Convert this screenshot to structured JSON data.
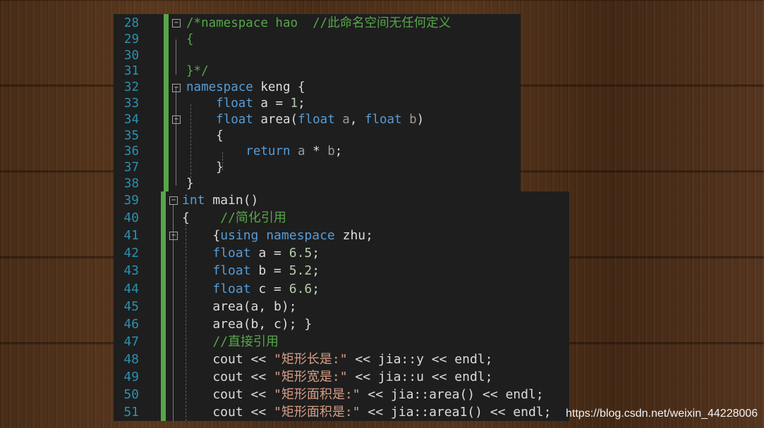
{
  "editor_top": {
    "lines": [
      {
        "num": "28",
        "tokens": [
          {
            "t": "/*namespace hao  //此命名空间无任何定义",
            "c": "c"
          }
        ]
      },
      {
        "num": "29",
        "tokens": [
          {
            "t": "{",
            "c": "c"
          }
        ]
      },
      {
        "num": "30",
        "tokens": []
      },
      {
        "num": "31",
        "tokens": [
          {
            "t": "}*/",
            "c": "c"
          }
        ]
      },
      {
        "num": "32",
        "tokens": [
          {
            "t": "namespace",
            "c": "k"
          },
          {
            "t": " keng {",
            "c": ""
          }
        ]
      },
      {
        "num": "33",
        "tokens": [
          {
            "t": "    ",
            "c": ""
          },
          {
            "t": "float",
            "c": "k"
          },
          {
            "t": " a = ",
            "c": ""
          },
          {
            "t": "1",
            "c": "n"
          },
          {
            "t": ";",
            "c": ""
          }
        ]
      },
      {
        "num": "34",
        "tokens": [
          {
            "t": "    ",
            "c": ""
          },
          {
            "t": "float",
            "c": "k"
          },
          {
            "t": " area(",
            "c": ""
          },
          {
            "t": "float",
            "c": "k"
          },
          {
            "t": " a",
            "c": "p"
          },
          {
            "t": ", ",
            "c": ""
          },
          {
            "t": "float",
            "c": "k"
          },
          {
            "t": " b",
            "c": "p"
          },
          {
            "t": ")",
            "c": ""
          }
        ]
      },
      {
        "num": "35",
        "tokens": [
          {
            "t": "    {",
            "c": ""
          }
        ]
      },
      {
        "num": "36",
        "tokens": [
          {
            "t": "        ",
            "c": ""
          },
          {
            "t": "return",
            "c": "k"
          },
          {
            "t": " a",
            "c": "p"
          },
          {
            "t": " * ",
            "c": ""
          },
          {
            "t": "b",
            "c": "p"
          },
          {
            "t": ";",
            "c": ""
          }
        ]
      },
      {
        "num": "37",
        "tokens": [
          {
            "t": "    }",
            "c": ""
          }
        ]
      },
      {
        "num": "38",
        "tokens": [
          {
            "t": "}",
            "c": ""
          }
        ]
      }
    ]
  },
  "editor_main": {
    "lines": [
      {
        "num": "39",
        "tokens": [
          {
            "t": "int",
            "c": "k"
          },
          {
            "t": " main()",
            "c": ""
          }
        ]
      },
      {
        "num": "40",
        "tokens": [
          {
            "t": "{    ",
            "c": ""
          },
          {
            "t": "//简化引用",
            "c": "c"
          }
        ]
      },
      {
        "num": "41",
        "tokens": [
          {
            "t": "    {",
            "c": ""
          },
          {
            "t": "using",
            "c": "k"
          },
          {
            "t": " ",
            "c": ""
          },
          {
            "t": "namespace",
            "c": "k"
          },
          {
            "t": " zhu;",
            "c": ""
          }
        ]
      },
      {
        "num": "42",
        "tokens": [
          {
            "t": "    ",
            "c": ""
          },
          {
            "t": "float",
            "c": "k"
          },
          {
            "t": " a = ",
            "c": ""
          },
          {
            "t": "6.5",
            "c": "n"
          },
          {
            "t": ";",
            "c": ""
          }
        ]
      },
      {
        "num": "43",
        "tokens": [
          {
            "t": "    ",
            "c": ""
          },
          {
            "t": "float",
            "c": "k"
          },
          {
            "t": " b = ",
            "c": ""
          },
          {
            "t": "5.2",
            "c": "n"
          },
          {
            "t": ";",
            "c": ""
          }
        ]
      },
      {
        "num": "44",
        "tokens": [
          {
            "t": "    ",
            "c": ""
          },
          {
            "t": "float",
            "c": "k"
          },
          {
            "t": " c = ",
            "c": ""
          },
          {
            "t": "6.6",
            "c": "n"
          },
          {
            "t": ";",
            "c": ""
          }
        ]
      },
      {
        "num": "45",
        "tokens": [
          {
            "t": "    area(a, b);",
            "c": ""
          }
        ]
      },
      {
        "num": "46",
        "tokens": [
          {
            "t": "    area(b, c); }",
            "c": ""
          }
        ]
      },
      {
        "num": "47",
        "tokens": [
          {
            "t": "    ",
            "c": ""
          },
          {
            "t": "//直接引用",
            "c": "c"
          }
        ]
      },
      {
        "num": "48",
        "tokens": [
          {
            "t": "    cout << ",
            "c": ""
          },
          {
            "t": "\"矩形长是:\"",
            "c": "s"
          },
          {
            "t": " << jia::y << endl;",
            "c": ""
          }
        ]
      },
      {
        "num": "49",
        "tokens": [
          {
            "t": "    cout << ",
            "c": ""
          },
          {
            "t": "\"矩形宽是:\"",
            "c": "s"
          },
          {
            "t": " << jia::u << endl;",
            "c": ""
          }
        ]
      },
      {
        "num": "50",
        "tokens": [
          {
            "t": "    cout << ",
            "c": ""
          },
          {
            "t": "\"矩形面积是:\"",
            "c": "s"
          },
          {
            "t": " << jia::area() << endl;",
            "c": ""
          }
        ]
      },
      {
        "num": "51",
        "tokens": [
          {
            "t": "    cout << ",
            "c": ""
          },
          {
            "t": "\"矩形面积是:\"",
            "c": "s"
          },
          {
            "t": " << jia::area1() << endl;",
            "c": ""
          }
        ]
      }
    ]
  },
  "watermark": "https://blog.csdn.net/weixin_44228006",
  "colors": {
    "editor_bg": "#1e1e1e",
    "line_number": "#2b91af",
    "keyword": "#569cd6",
    "comment": "#57a64a",
    "string": "#d69d85",
    "number": "#b5cea8",
    "parameter": "#9a9a9a",
    "change_bar": "#57a64a"
  }
}
